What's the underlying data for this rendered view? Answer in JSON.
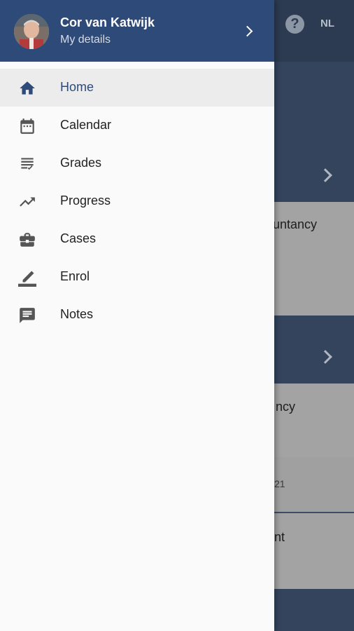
{
  "topbar": {
    "help_icon": "question-circle-icon",
    "help_glyph": "?",
    "language": "NL"
  },
  "background": {
    "card1_text": "ountancy",
    "card2_text": "ncy",
    "card3_text": "21",
    "card4_text": "nt"
  },
  "drawer": {
    "user": {
      "name": "Cor van Katwijk",
      "subtitle": "My details",
      "avatar_icon": "user-avatar"
    },
    "menu": [
      {
        "label": "Home",
        "icon": "home-icon",
        "active": true
      },
      {
        "label": "Calendar",
        "icon": "calendar-icon",
        "active": false
      },
      {
        "label": "Grades",
        "icon": "grades-list-icon",
        "active": false
      },
      {
        "label": "Progress",
        "icon": "trending-up-icon",
        "active": false
      },
      {
        "label": "Cases",
        "icon": "briefcase-icon",
        "active": false
      },
      {
        "label": "Enrol",
        "icon": "pencil-icon",
        "active": false
      },
      {
        "label": "Notes",
        "icon": "notes-icon",
        "active": false
      }
    ]
  },
  "colors": {
    "brand": "#2e4a78",
    "drawer_bg": "#fafafa",
    "active_item_bg": "#ececec",
    "icon": "#555555"
  }
}
